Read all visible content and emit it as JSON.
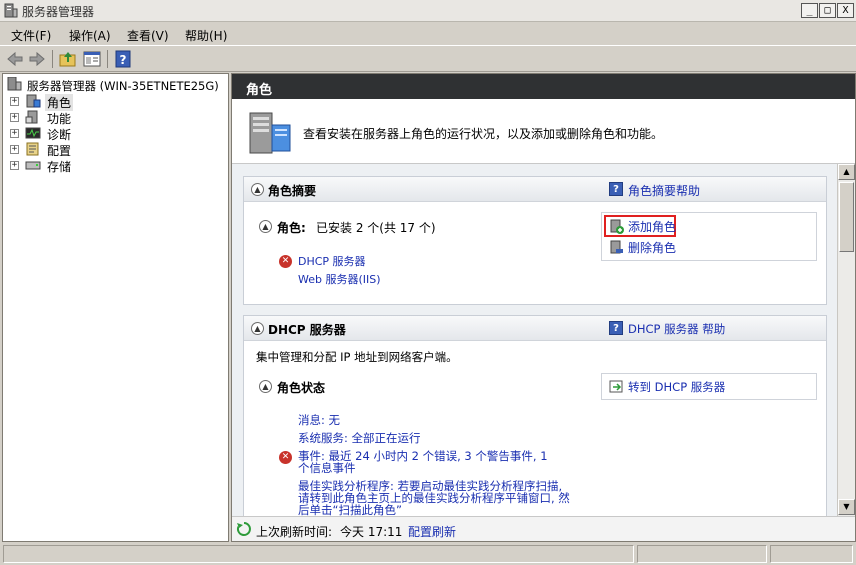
{
  "window": {
    "title": "服务器管理器",
    "min_glyph": "_",
    "max_glyph": "□",
    "close_glyph": "X"
  },
  "menu": [
    "文件(F)",
    "操作(A)",
    "查看(V)",
    "帮助(H)"
  ],
  "tree": {
    "root": "服务器管理器 (WIN-35ETNETE25G)",
    "items": [
      "角色",
      "功能",
      "诊断",
      "配置",
      "存储"
    ]
  },
  "right": {
    "header": "角色",
    "intro": "查看安装在服务器上角色的运行状况，以及添加或删除角色和功能。",
    "role_summary": {
      "title": "角色摘要",
      "help": "角色摘要帮助",
      "installed_label": "角色:",
      "installed_text": "已安装 2 个(共 17 个)",
      "roles": [
        "DHCP 服务器",
        "Web 服务器(IIS)"
      ],
      "add_roles": "添加角色",
      "remove_roles": "删除角色"
    },
    "dhcp": {
      "title": "DHCP 服务器",
      "help": "DHCP 服务器 帮助",
      "description": "集中管理和分配 IP 地址到网络客户端。",
      "status_title": "角色状态",
      "goto": "转到 DHCP 服务器",
      "messages": "消息: 无",
      "services": "系统服务: 全部正在运行",
      "events_line1": "事件: 最近 24 小时内 2 个错误, 3 个警告事件, 1",
      "events_line2": "个信息事件",
      "bpa_line1": "最佳实践分析程序: 若要启动最佳实践分析程序扫描,",
      "bpa_line2": "请转到此角色主页上的最佳实践分析程序平铺窗口, 然",
      "bpa_line3": "后单击“扫描此角色”"
    },
    "refresh": {
      "label": "上次刷新时间:",
      "time": "今天 17:11",
      "link": "配置刷新"
    }
  }
}
